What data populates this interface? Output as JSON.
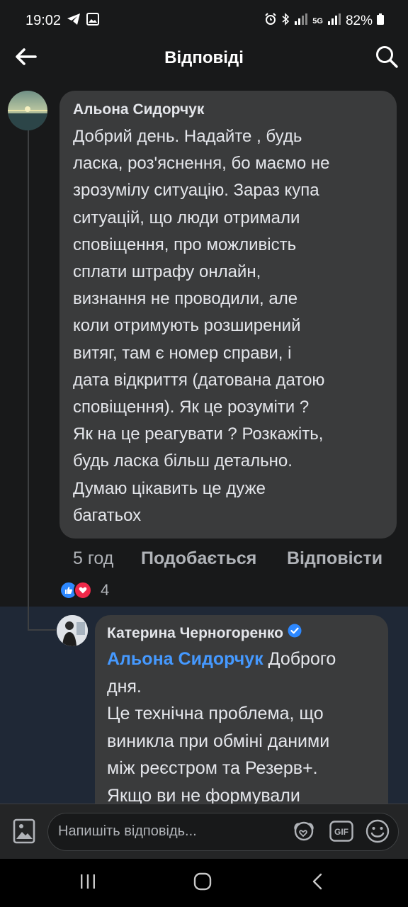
{
  "status_bar": {
    "time": "19:02",
    "battery": "82%",
    "network_5g": "5G",
    "left_icons": [
      "telegram-icon",
      "image-icon"
    ],
    "right_icons": [
      "alarm-icon",
      "bluetooth-icon",
      "signal-icon",
      "battery-icon"
    ]
  },
  "header": {
    "title": "Відповіді",
    "back_icon": "arrow-left-icon",
    "search_icon": "search-icon"
  },
  "comment": {
    "author": "Альона Сидорчук",
    "text": "Добрий день. Надайте , будь\nласка, роз'яснення, бо маємо не\nзрозумілу ситуацію. Зараз купа\nситуацій, що люди отримали\nсповіщення, про можливість\nсплати штрафу онлайн,\nвизнання не проводили, але\nколи отримують розширений\nвитяг,  там є номер справи, і\nдата відкриття (датована датою\nсповіщення). Як це розуміти ?\nЯк на це реагувати ? Розкажіть,\nбудь ласка більш детально.\nДумаю цікавить це дуже\nбагатьох",
    "time": "5 год",
    "like_label": "Подобається",
    "reply_label": "Відповісти",
    "reaction_count": "4",
    "reactions": [
      "like-icon",
      "love-icon"
    ]
  },
  "reply": {
    "author": "Катерина Черногоренко",
    "verified": true,
    "mention": "Альона Сидорчук",
    "line1_rest": " Доброго",
    "line2": "дня.",
    "line3": "Це технічна проблема, що",
    "line4": "виникла при обміні даними",
    "line5": "між реєстром та Резерв+.",
    "line6": "Якщо ви не формували"
  },
  "composer": {
    "placeholder": "Напишіть відповідь...",
    "icons": [
      "photo-icon",
      "avatar-sticker-icon",
      "gif-icon",
      "emoji-icon"
    ]
  },
  "colors": {
    "background": "#18191a",
    "bubble": "#3a3b3c",
    "reply_highlight": "#1f2836",
    "mention": "#4599ff",
    "verified": "#2d88ff"
  }
}
